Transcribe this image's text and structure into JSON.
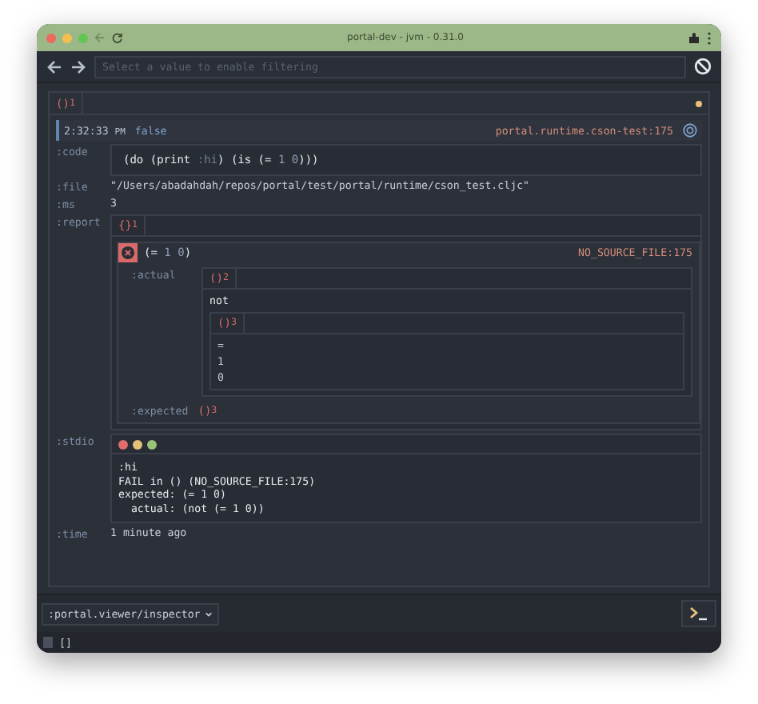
{
  "window": {
    "title": "portal-dev - jvm - 0.31.0"
  },
  "search": {
    "placeholder": "Select a value to enable filtering"
  },
  "root": {
    "badge": "()",
    "count": "1"
  },
  "entry": {
    "time": "2:32:33",
    "ampm": "PM",
    "value": "false",
    "source": "portal.runtime.cson-test:175"
  },
  "fields": [
    {
      "key": ":code",
      "kind": "code",
      "tokens": [
        {
          "text": "(do (print ",
          "kind": "plain"
        },
        {
          "text": ":hi",
          "kind": "keyword"
        },
        {
          "text": ") (is (= ",
          "kind": "plain"
        },
        {
          "text": "1 0",
          "kind": "number"
        },
        {
          "text": ")))",
          "kind": "plain"
        }
      ]
    },
    {
      "key": ":file",
      "kind": "text",
      "value": "\"/Users/abadahdah/repos/portal/test/portal/runtime/cson_test.cljc\""
    },
    {
      "key": ":ms",
      "kind": "text",
      "value": "3"
    },
    {
      "key": ":report",
      "kind": "report",
      "report": {
        "badge": "{}",
        "count": "1",
        "passed": false,
        "expr": [
          {
            "text": "(= ",
            "kind": "plain"
          },
          {
            "text": "1 0",
            "kind": "number"
          },
          {
            "text": ")",
            "kind": "plain"
          }
        ],
        "location": "NO_SOURCE_FILE:175",
        "actual": {
          "key": ":actual",
          "badge": "()",
          "count": "2",
          "head": "not",
          "inner": {
            "badge": "()",
            "count": "3",
            "items": [
              "=",
              "1",
              "0"
            ]
          }
        },
        "expected": {
          "key": ":expected",
          "badge": "()",
          "count": "3"
        }
      }
    },
    {
      "key": ":stdio",
      "kind": "stdio",
      "lines": [
        ":hi",
        "FAIL in () (NO_SOURCE_FILE:175)",
        "expected: (= 1 0)",
        "  actual: (not (= 1 0))"
      ]
    },
    {
      "key": ":time",
      "kind": "text",
      "value": "1 minute ago"
    }
  ],
  "viewer": {
    "value": ":portal.viewer/inspector"
  },
  "footer": {
    "text": "[]"
  }
}
